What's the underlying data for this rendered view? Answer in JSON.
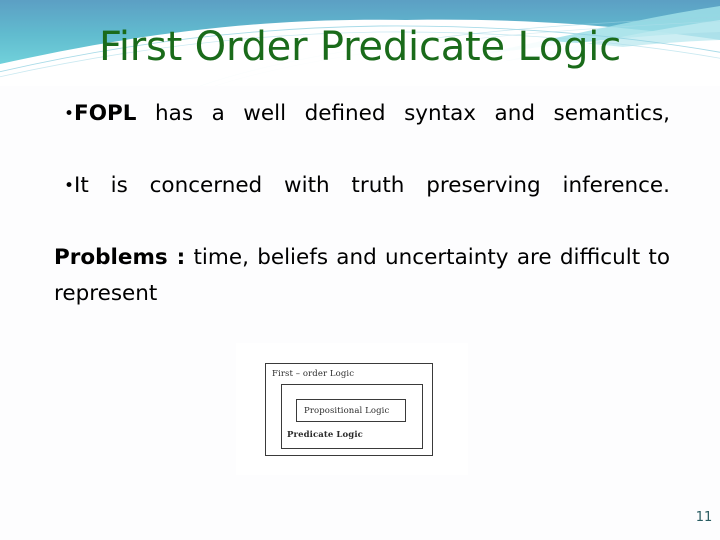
{
  "slide": {
    "title": "First Order Predicate Logic",
    "title_color": "#1a6b1a",
    "background_color": "#ffffff",
    "page_number": "11",
    "page_number_color": "#2a5d62"
  },
  "header": {
    "band_colors": {
      "deep_blue": "#5aa8c8",
      "cyan": "#6ed4dd",
      "pale_cyan": "#a9e2ea",
      "white": "#ffffff",
      "swoosh_line": "#7fc4d8"
    }
  },
  "body": {
    "bullet_char": "•",
    "paragraphs": [
      {
        "bulleted": true,
        "bold_lead": "FOPL",
        "text": " has a well defined syntax and semantics,"
      },
      {
        "bulleted": true,
        "bold_lead": "",
        "text": "It is concerned with truth preserving inference."
      },
      {
        "bulleted": false,
        "bold_lead": "Problems :",
        "text": " time, beliefs and uncertainty are difficult to represent"
      }
    ]
  },
  "diagram": {
    "outer_label": "First – order Logic",
    "inner_label": "Propositional Logic",
    "bottom_label": "Predicate Logic",
    "border_color": "#3a3a3a",
    "fill_color": "#ffffff"
  }
}
